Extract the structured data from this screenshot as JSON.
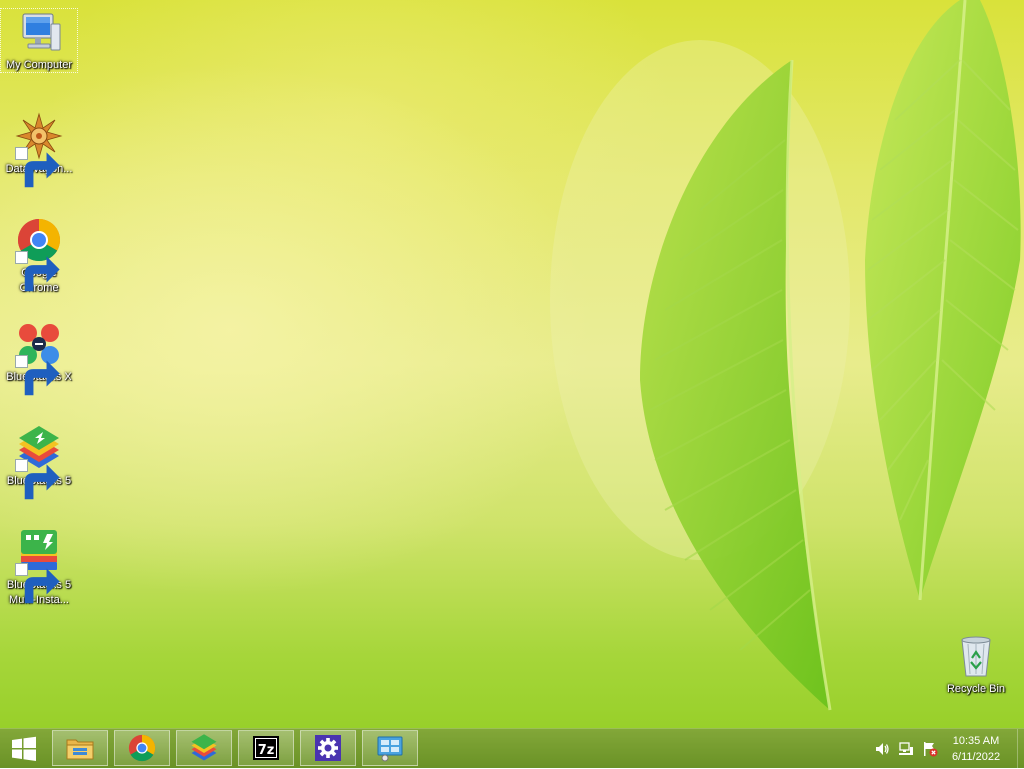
{
  "desktop": {
    "icons": [
      {
        "label": "My Computer",
        "icon": "computer-icon"
      },
      {
        "label": "DataWagon...",
        "icon": "datawagon-icon"
      },
      {
        "label": "Google Chrome",
        "icon": "chrome-icon"
      },
      {
        "label": "BlueStacks X",
        "icon": "bluestacks-x-icon"
      },
      {
        "label": "BlueStacks 5",
        "icon": "bluestacks-5-icon"
      },
      {
        "label": "BlueStacks 5 Multi-Insta...",
        "icon": "bluestacks-multi-instance-icon"
      }
    ],
    "recycle_bin": {
      "label": "Recycle Bin",
      "icon": "recycle-bin-icon"
    }
  },
  "taskbar": {
    "start": {
      "icon": "windows-logo-icon"
    },
    "pinned": [
      {
        "icon": "file-explorer-icon"
      },
      {
        "icon": "chrome-icon"
      },
      {
        "icon": "bluestacks-icon"
      },
      {
        "icon": "7zip-icon"
      },
      {
        "icon": "settings-gear-icon"
      },
      {
        "icon": "control-panel-icon"
      }
    ],
    "tray": {
      "icons": [
        "volume-icon",
        "network-icon",
        "action-center-flag-icon"
      ],
      "time": "10:35 AM",
      "date": "6/11/2022"
    }
  },
  "colors": {
    "taskbar": "#6f9a22",
    "chrome_red": "#db4437",
    "chrome_green": "#0f9d58",
    "chrome_yellow": "#f4b400",
    "chrome_blue": "#4285f4"
  }
}
